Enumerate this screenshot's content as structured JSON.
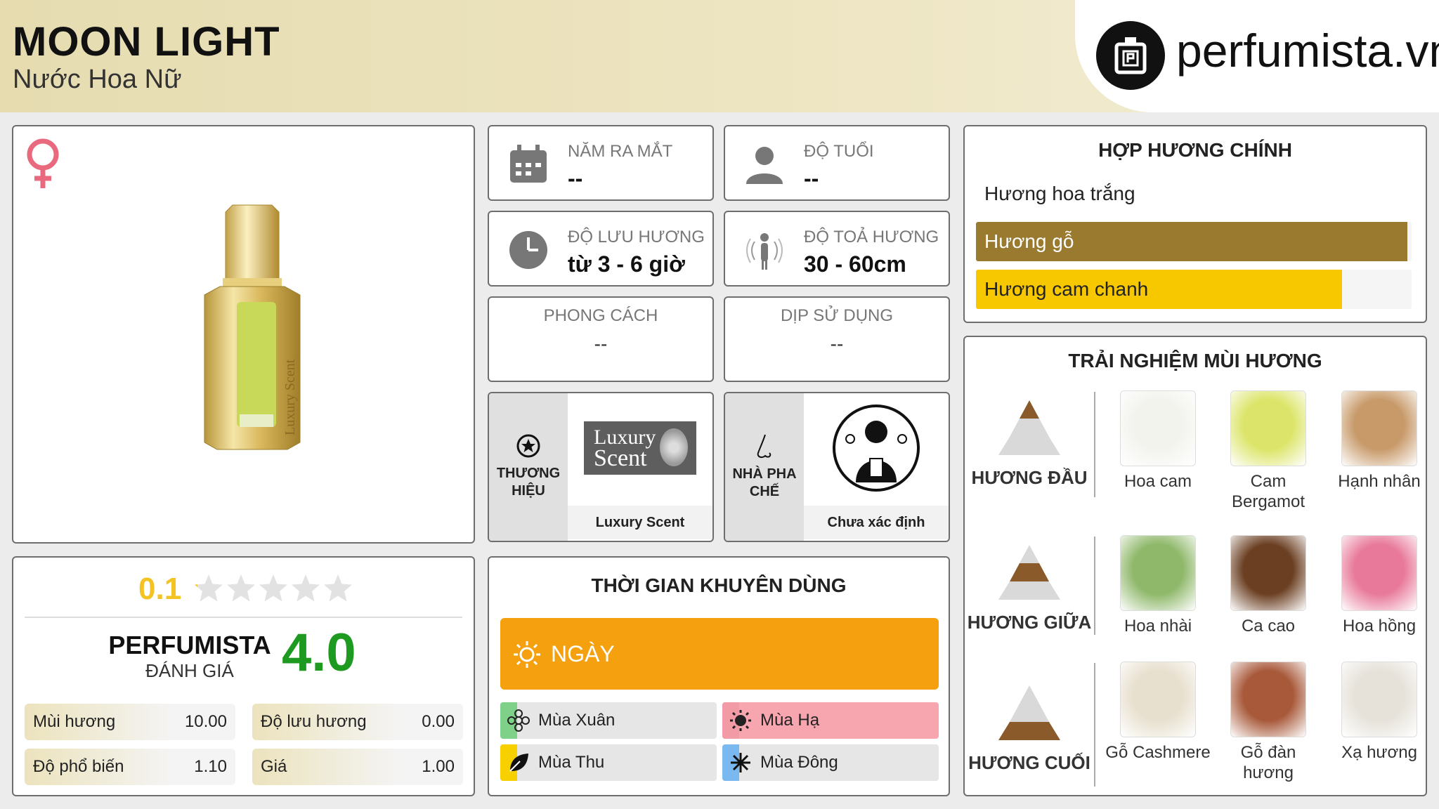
{
  "header": {
    "title": "MOON LIGHT",
    "subtitle": "Nước Hoa Nữ",
    "logo_text": "perfumista.vn"
  },
  "product": {
    "gender_icon": "female-symbol-icon",
    "bottle_label": "Luxury Scent"
  },
  "info": {
    "release_year": {
      "label": "NĂM RA MẮT",
      "value": "--"
    },
    "age": {
      "label": "ĐỘ TUỔI",
      "value": "--"
    },
    "longevity": {
      "label": "ĐỘ LƯU HƯƠNG",
      "value": "từ 3 - 6 giờ"
    },
    "sillage": {
      "label": "ĐỘ TOẢ HƯƠNG",
      "value": "30 - 60cm"
    },
    "style": {
      "label": "PHONG CÁCH",
      "value": "--"
    },
    "occasion": {
      "label": "DỊP SỬ DỤNG",
      "value": "--"
    },
    "brand": {
      "label_1": "THƯƠNG",
      "label_2": "HIỆU",
      "logo_line_1": "Luxury",
      "logo_line_2": "Scent",
      "name": "Luxury Scent"
    },
    "perfumer": {
      "label_1": "NHÀ PHA",
      "label_2": "CHẾ",
      "name": "Chưa xác định"
    }
  },
  "accords": {
    "title": "HỢP HƯƠNG CHÍNH",
    "items": [
      {
        "label": "Hương hoa trắng",
        "fraction": 1.0,
        "color": "#ffffff",
        "text_color": "#222222"
      },
      {
        "label": "Hương gỗ",
        "fraction": 0.99,
        "color": "#9a7a2e",
        "text_color": "#ffffff"
      },
      {
        "label": "Hương cam chanh",
        "fraction": 0.84,
        "color": "#f7c800",
        "text_color": "#222222"
      }
    ]
  },
  "experience": {
    "title": "TRẢI NGHIỆM MÙI HƯƠNG",
    "tiers": [
      {
        "label": "HƯƠNG ĐẦU",
        "notes": [
          "Hoa cam",
          "Cam Bergamot",
          "Hạnh nhân"
        ]
      },
      {
        "label": "HƯƠNG GIỮA",
        "notes": [
          "Hoa nhài",
          "Ca cao",
          "Hoa hồng"
        ]
      },
      {
        "label": "HƯƠNG CUỐI",
        "notes": [
          "Gỗ Cashmere",
          "Gỗ đàn hương",
          "Xạ hương"
        ]
      }
    ]
  },
  "rating": {
    "user_score": "0.1",
    "user_stars": 0.1,
    "perfumista_label": "PERFUMISTA",
    "perfumista_sub": "ĐÁNH GIÁ",
    "perfumista_score": "4.0",
    "stats": [
      {
        "label": "Mùi hương",
        "value": "10.00"
      },
      {
        "label": "Độ lưu hương",
        "value": "0.00"
      },
      {
        "label": "Độ phổ biến",
        "value": "1.10"
      },
      {
        "label": "Giá",
        "value": "1.00"
      }
    ]
  },
  "time": {
    "title": "THỜI GIAN KHUYÊN DÙNG",
    "day_label": "NGÀY",
    "seasons": [
      {
        "label": "Mùa Xuân",
        "color": "#7fd18a"
      },
      {
        "label": "Mùa Hạ",
        "color": "#f29aa5"
      },
      {
        "label": "Mùa Thu",
        "color": "#f7d000"
      },
      {
        "label": "Mùa Đông",
        "color": "#7ab8f0"
      }
    ]
  },
  "colors": {
    "accent_gold": "#9a7a2e",
    "day_orange": "#f5a00f",
    "score_green": "#1e9a20",
    "star_gold": "#f3c323"
  }
}
